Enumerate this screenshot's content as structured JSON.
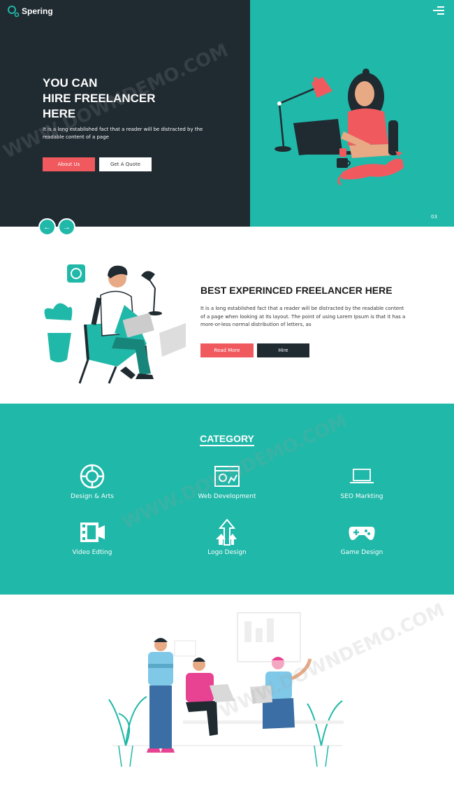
{
  "header": {
    "brand": "Spering",
    "menu_icon": "hamburger-menu-icon"
  },
  "hero": {
    "title_lines": [
      "YOU CAN",
      "HIRE FREELANCER",
      "HERE"
    ],
    "description": "It is a long established fact that a reader will be distracted by the readable content of a page",
    "about_button": "About Us",
    "quote_button": "Get A Quote",
    "slide_number": "03",
    "prev_icon": "arrow-left-icon",
    "next_icon": "arrow-right-icon",
    "colors": {
      "dark": "#1f2a31",
      "teal": "#20b8a8",
      "accent": "#f05a5f"
    }
  },
  "about": {
    "title": "BEST EXPERINCED FREELANCER HERE",
    "description": "It is a long established fact that a reader will be distracted by the readable content of a page when looking at its layout. The point of using Lorem Ipsum is that it has a more-or-less normal distribution of letters, as",
    "read_more_button": "Read More",
    "hire_button": "Hire"
  },
  "category": {
    "title": "CATEGORY",
    "items": [
      {
        "label": "Design & Arts",
        "icon": "palette-icon"
      },
      {
        "label": "Web Development",
        "icon": "web-browser-icon"
      },
      {
        "label": "SEO Markting",
        "icon": "laptop-icon"
      },
      {
        "label": "Video Edting",
        "icon": "film-strip-icon"
      },
      {
        "label": "Logo Design",
        "icon": "arrows-up-icon"
      },
      {
        "label": "Game Design",
        "icon": "gamepad-icon"
      }
    ]
  },
  "watermark": "WWW.DOWNDEMO.COM"
}
